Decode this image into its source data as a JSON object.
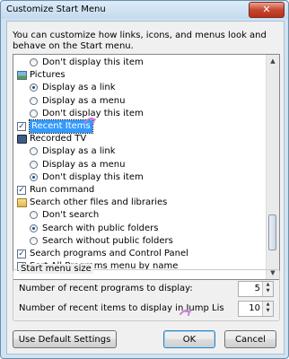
{
  "window": {
    "title": "Customize Start Menu",
    "close_glyph": "✕"
  },
  "intro_text": "You can customize how links, icons, and menus look and behave on the Start menu.",
  "list_items": [
    {
      "kind": "radio",
      "checked": false,
      "indent": 1,
      "label": "Don't display this item"
    },
    {
      "kind": "header",
      "icon": "pictures-icon",
      "label": "Pictures"
    },
    {
      "kind": "radio",
      "checked": true,
      "indent": 1,
      "label": "Display as a link"
    },
    {
      "kind": "radio",
      "checked": false,
      "indent": 1,
      "label": "Display as a menu"
    },
    {
      "kind": "radio",
      "checked": false,
      "indent": 1,
      "label": "Don't display this item"
    },
    {
      "kind": "check",
      "checked": true,
      "indent": 0,
      "label": "Recent Items",
      "selected": true
    },
    {
      "kind": "header",
      "icon": "recorded-tv-icon",
      "label": "Recorded TV"
    },
    {
      "kind": "radio",
      "checked": false,
      "indent": 1,
      "label": "Display as a link"
    },
    {
      "kind": "radio",
      "checked": false,
      "indent": 1,
      "label": "Display as a menu"
    },
    {
      "kind": "radio",
      "checked": true,
      "indent": 1,
      "label": "Don't display this item"
    },
    {
      "kind": "check",
      "checked": true,
      "indent": 0,
      "label": "Run command"
    },
    {
      "kind": "header",
      "icon": "search-folder-icon",
      "label": "Search other files and libraries"
    },
    {
      "kind": "radio",
      "checked": false,
      "indent": 1,
      "label": "Don't search"
    },
    {
      "kind": "radio",
      "checked": true,
      "indent": 1,
      "label": "Search with public folders"
    },
    {
      "kind": "radio",
      "checked": false,
      "indent": 1,
      "label": "Search without public folders"
    },
    {
      "kind": "check",
      "checked": true,
      "indent": 0,
      "label": "Search programs and Control Panel"
    },
    {
      "kind": "check",
      "checked": true,
      "indent": 0,
      "label": "Sort All Programs menu by name"
    }
  ],
  "start_menu_size": {
    "title": "Start menu size",
    "recent_programs_label": "Number of recent programs to display:",
    "recent_programs_value": "5",
    "recent_items_label": "Number of recent items to display in Jump Lis",
    "recent_items_value": "10"
  },
  "buttons": {
    "defaults": "Use Default Settings",
    "ok": "OK",
    "cancel": "Cancel"
  },
  "colors": {
    "selection": "#3399ff",
    "annotation_cursor": "#c77fd8"
  }
}
